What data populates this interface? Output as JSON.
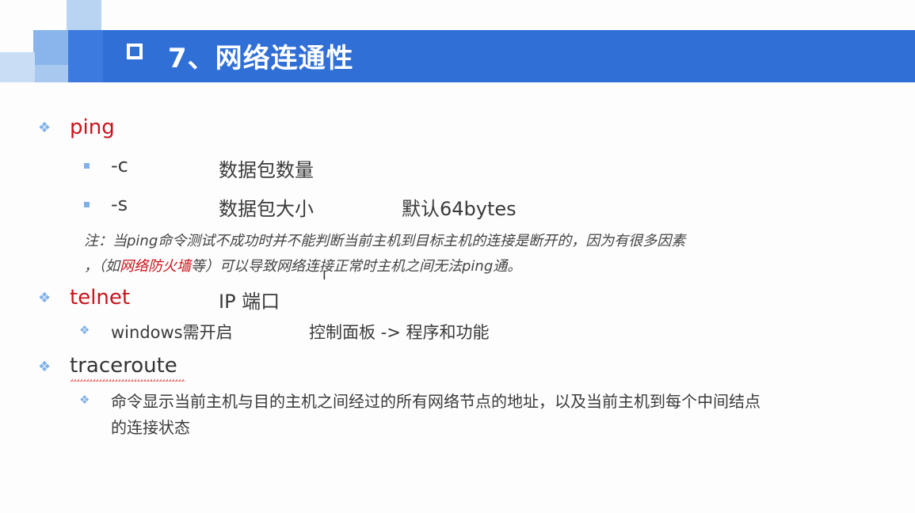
{
  "title": "7、网络连通性",
  "items": {
    "ping": {
      "label": "ping",
      "c_flag": "-c",
      "c_desc": "数据包数量",
      "s_flag": "-s",
      "s_desc": "数据包大小",
      "s_default": "默认64bytes",
      "note_line1": "注：当ping命令测试不成功时并不能判断当前主机到目标主机的连接是断开的，因为有很多因素",
      "note_pre": "，（如",
      "note_red": "网络防火墙",
      "note_post": "等）可以导致网络连接正常时主机之间无法ping通。"
    },
    "telnet": {
      "label": "telnet",
      "args": "IP 端口",
      "sub_left": "windows需开启",
      "sub_right": "控制面板 -> 程序和功能"
    },
    "traceroute": {
      "label": "traceroute",
      "desc_line1": "命令显示当前主机与目的主机之间经过的所有网络节点的地址，以及当前主机到每个中间结点",
      "desc_line2": "的连接状态"
    }
  },
  "colors": {
    "accent": "#2f6fd6",
    "highlight": "#c8141c",
    "bullet": "#7fb0e8"
  }
}
